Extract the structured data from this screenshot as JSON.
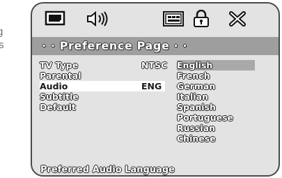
{
  "side_caption": [
    "g",
    "s"
  ],
  "icons": [
    "monitor-icon",
    "speaker-icon",
    "dolby-panel-icon",
    "lock-icon",
    "exit-icon"
  ],
  "header": {
    "title": "· · Preference Page · ·"
  },
  "menu": [
    {
      "label": "TV Type",
      "value": "NTSC"
    },
    {
      "label": "Parental",
      "value": ""
    },
    {
      "label": "Audio",
      "value": "ENG"
    },
    {
      "label": "Subtitle",
      "value": ""
    },
    {
      "label": "Default",
      "value": ""
    }
  ],
  "selected_menu_item": "Audio",
  "options": [
    "English",
    "French",
    "German",
    "Italian",
    "Spanish",
    "Portuguese",
    "Russian",
    "Chinese"
  ],
  "highlighted_option": "English",
  "status": "Preferred Audio Language",
  "colors": {
    "screen_bg": "#e3e3e3",
    "header_bar": "#9e9e9e",
    "option_highlight": "#a9a9a9"
  }
}
